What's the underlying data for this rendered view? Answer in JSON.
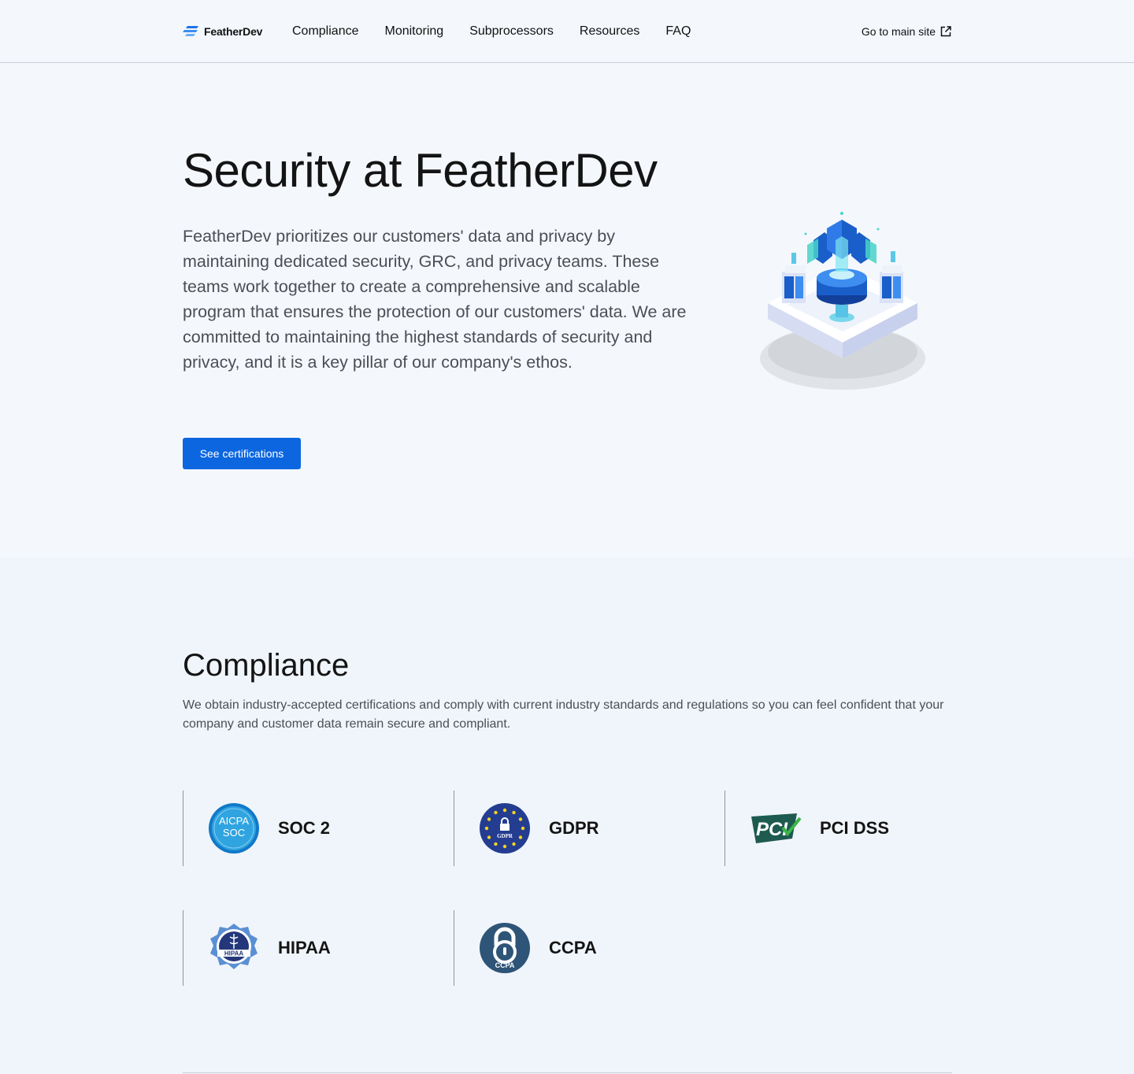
{
  "header": {
    "brand": "FeatherDev",
    "nav": [
      "Compliance",
      "Monitoring",
      "Subprocessors",
      "Resources",
      "FAQ"
    ],
    "main_site_link": "Go to main site"
  },
  "hero": {
    "title": "Security at FeatherDev",
    "description": "FeatherDev prioritizes our customers' data and privacy by maintaining dedicated security, GRC, and privacy teams. These teams work together to create a comprehensive and scalable program that ensures the protection of our customers' data. We are committed to maintaining the highest standards of security and privacy, and it is a key pillar of our company's ethos.",
    "cta_label": "See certifications",
    "accent_color": "#0b66e0"
  },
  "compliance": {
    "title": "Compliance",
    "description": "We obtain industry-accepted certifications and comply with current industry standards and regulations so you can feel confident that your company and customer data remain secure and compliant.",
    "certifications": [
      {
        "label": "SOC 2",
        "icon": "aicpa-soc-badge",
        "badge_text": [
          "AICPA",
          "SOC"
        ]
      },
      {
        "label": "GDPR",
        "icon": "gdpr-eu-badge",
        "badge_text": [
          "GDPR"
        ]
      },
      {
        "label": "PCI DSS",
        "icon": "pci-logo",
        "badge_text": [
          "PCI"
        ]
      },
      {
        "label": "HIPAA",
        "icon": "hipaa-badge",
        "badge_text": [
          "HIPAA"
        ]
      },
      {
        "label": "CCPA",
        "icon": "ccpa-lock-badge",
        "badge_text": [
          "CCPA"
        ]
      }
    ]
  }
}
